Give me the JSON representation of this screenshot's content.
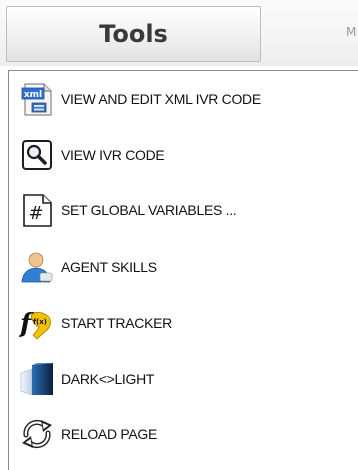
{
  "menubar": {
    "tools_label": "Tools",
    "next_tab_label": "M"
  },
  "tools_menu": {
    "items": [
      {
        "label": "VIEW AND EDIT XML IVR CODE",
        "icon": "xml-file-icon"
      },
      {
        "label": "VIEW IVR CODE",
        "icon": "magnifier-icon"
      },
      {
        "label": "SET GLOBAL VARIABLES ...",
        "icon": "hash-file-icon"
      },
      {
        "label": "AGENT SKILLS",
        "icon": "agent-icon"
      },
      {
        "label": "START TRACKER",
        "icon": "function-icon"
      },
      {
        "label": "DARK<>LIGHT",
        "icon": "dark-light-icon"
      },
      {
        "label": "RELOAD PAGE",
        "icon": "reload-icon"
      }
    ],
    "icon_text": {
      "xml": "xml",
      "hash": "#",
      "function": "f(x)"
    }
  },
  "colors": {
    "menu_border": "#8c8c8c",
    "tab_text": "#3a3a3a",
    "item_text": "#111111"
  }
}
